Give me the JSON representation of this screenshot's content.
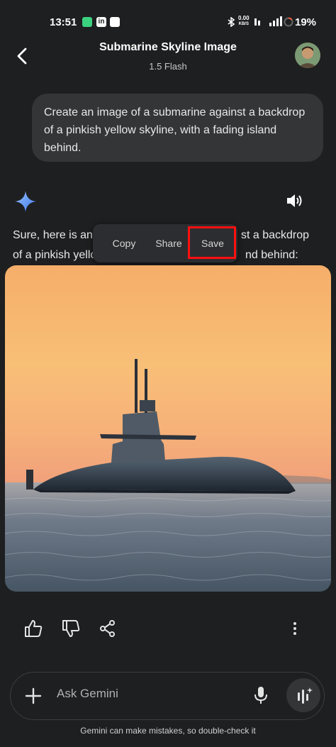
{
  "status_bar": {
    "time": "13:51",
    "net_speed_value": "0.00",
    "net_speed_unit": "KB/S",
    "battery": "19%",
    "notification_icons": [
      "app-icon",
      "linkedin-icon",
      "app-icon"
    ]
  },
  "header": {
    "title": "Submarine Skyline Image",
    "model": "1.5 Flash"
  },
  "user_message": {
    "text": "Create an image of a submarine against a backdrop of a pinkish yellow skyline, with a fading island behind."
  },
  "response": {
    "line1_start": "Sure, here is an",
    "line1_end": "st a backdrop",
    "line2_start": "of a pinkish yello",
    "line2_end": "nd behind:"
  },
  "context_menu": {
    "copy": "Copy",
    "share": "Share",
    "save": "Save"
  },
  "input": {
    "placeholder": "Ask Gemini"
  },
  "footer": {
    "disclaimer": "Gemini can make mistakes, so double-check it"
  },
  "colors": {
    "background": "#1e1f20",
    "bubble": "#333537",
    "highlight": "#ff1010",
    "gemini_star": "#4c8df6"
  }
}
